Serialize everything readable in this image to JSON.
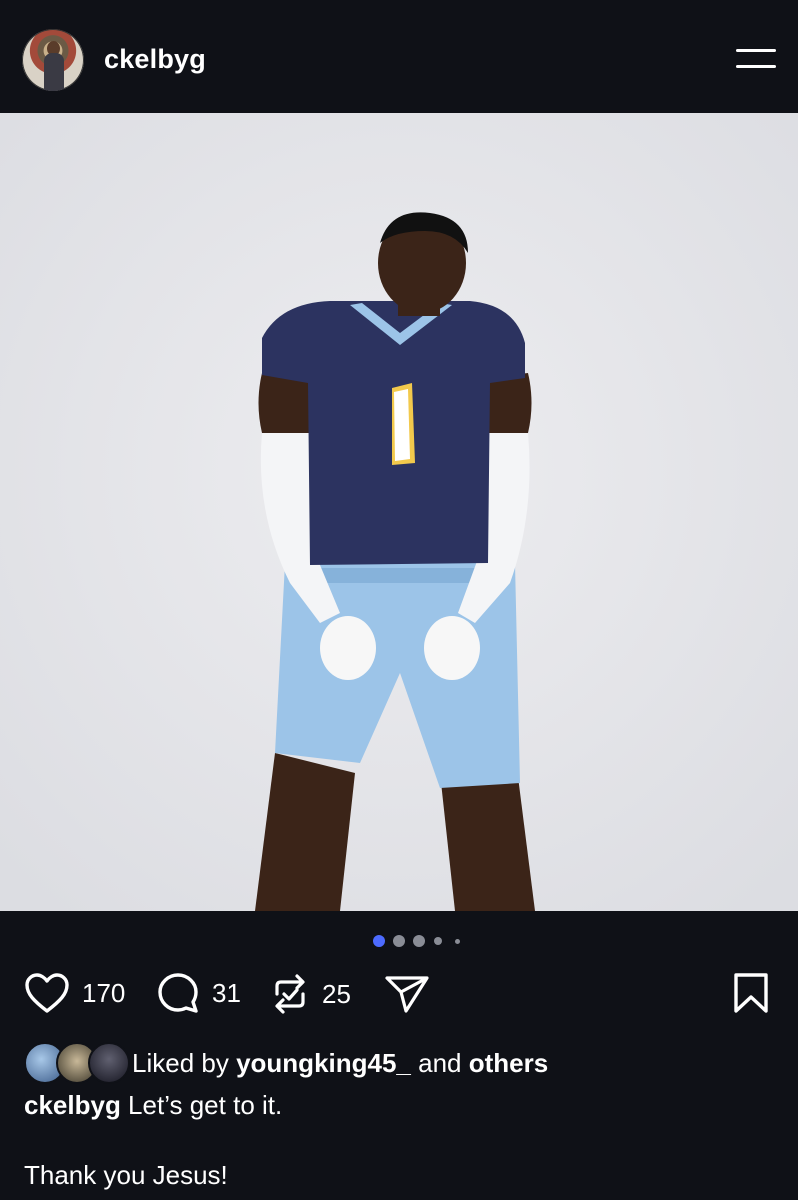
{
  "header": {
    "username": "ckelbyg",
    "menu_icon": "hamburger-menu-icon"
  },
  "post": {
    "image_description_icon": "photo",
    "carousel": {
      "count": 5,
      "active_index": 0
    }
  },
  "actions": {
    "like_count": "170",
    "comment_count": "31",
    "repost_count": "25",
    "icons": [
      "heart-icon",
      "comment-icon",
      "repost-icon",
      "send-icon",
      "bookmark-icon"
    ]
  },
  "likes": {
    "prefix": "Liked by ",
    "user": "youngking45_",
    "middle": " and ",
    "others": "others"
  },
  "caption": {
    "username": "ckelbyg",
    "text": " Let’s get to it.",
    "line2": "Thank you Jesus!"
  },
  "colors": {
    "background": "#0f1117",
    "active_dot": "#4d6bff",
    "inactive_dot": "#8a8d96"
  }
}
